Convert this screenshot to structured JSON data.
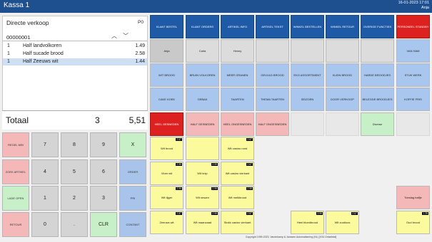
{
  "window": {
    "title": "Kassa 1",
    "date": "16-01-2023",
    "time": "17:01",
    "user": "Anja"
  },
  "receipt": {
    "customer": "Directe verkoop",
    "page": "P0",
    "code": "00000001",
    "lines": [
      {
        "qty": "1",
        "desc": "Half landvolkoren",
        "price": "1.49"
      },
      {
        "qty": "1",
        "desc": "Half sucade brood",
        "price": "2.58"
      },
      {
        "qty": "1",
        "desc": "Half Zeeuws wit",
        "price": "1.44"
      }
    ],
    "total_label": "Totaal",
    "total_count": "3",
    "total_amount": "5,51"
  },
  "keypad": {
    "regel_min": "REGEL MIN",
    "zoek_artikel": "ZOEK ARTIKEL",
    "lade_open": "LADE OPEN",
    "retour": "RETOUR",
    "k7": "7",
    "k8": "8",
    "k9": "9",
    "kx": "X",
    "k4": "4",
    "k5": "5",
    "k6": "6",
    "order": "ORDER",
    "k1": "1",
    "k2": "2",
    "k3": "3",
    "prijs": "PRI",
    "k0": "0",
    "kdot": ".",
    "clr": "CLR",
    "contant": "CONTANT"
  },
  "tiles": {
    "r1": [
      "KLANT BESTEL",
      "KLANT ORDERS",
      "ARTIKEL INFO",
      "ARTIKEL TEKST",
      "WINKEL BESTELLEN",
      "WINKEL RETOUR",
      "OVERIGE FUNCTIES",
      "PERSONEEL STANDBY"
    ],
    "r2": [
      "Anja",
      "Carla",
      "Henny",
      "",
      "",
      "",
      "",
      "VAN HAM"
    ],
    "r3": [
      "WIT BROOD",
      "BRUIN VOLKOREN",
      "MEER GRANEN",
      "GEVULD BROOD",
      "EKO ASSORTIMENT",
      "KLEIN BROOD",
      "HARDE BROODJES",
      "STUK WERK"
    ],
    "r4": [
      "CAKE KOEK",
      "GEBAK",
      "TAARTEN",
      "THEMA TAARTEN",
      "SEIZOEN",
      "DOOR VERKOOP",
      "BELEGDE BROODJES",
      "KOFFIE FRIS"
    ],
    "r5": [
      "HEEL GESNEDEN",
      "HALF GESNEDEN",
      "HEEL ONGESNEDEN",
      "HALF ONGESNEDEN",
      "",
      "",
      "Diverse",
      ""
    ],
    "r6": [
      {
        "label": "Wit brood",
        "price": "2.67"
      },
      {
        "label": "",
        "price": ""
      },
      {
        "label": "Wit casino rond",
        "price": "2.67"
      }
    ],
    "r7": [
      {
        "label": "Vloer wit",
        "price": "2.99"
      },
      {
        "label": "Wit knip",
        "price": "2.99"
      },
      {
        "label": "Wit casino vierkant",
        "price": "2.67"
      }
    ],
    "r8": [
      {
        "label": "Wit tijger",
        "price": "2.99"
      },
      {
        "label": "Wit sesam",
        "price": "2.99"
      },
      {
        "label": "Wit melkbrood",
        "price": "2.99"
      },
      {
        "label": "Toeslag halfje",
        "price": ""
      }
    ],
    "r9": [
      {
        "label": "Zeeuws wit",
        "price": "2.87"
      },
      {
        "label": "Wit maanzaad",
        "price": "2.99"
      },
      {
        "label": "Stokk casino vierkant",
        "price": "2.87"
      },
      {
        "label": "Heel bloedbrood",
        "price": "3.99"
      },
      {
        "label": "Wit zoutloos",
        "price": "2.67"
      },
      {
        "label": "Oud brood",
        "price": "1.25"
      }
    ]
  },
  "footer": "Copyright 1999-2023, Vanenkamp & Janssen Automatisering (NL) [V34 Ontwikkel]"
}
